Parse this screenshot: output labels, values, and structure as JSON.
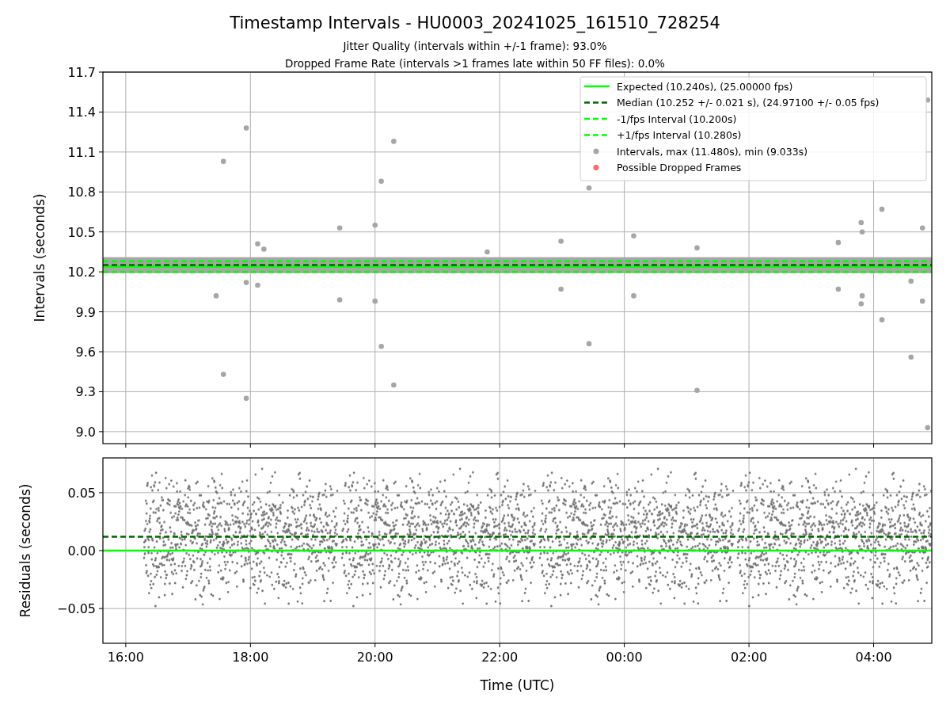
{
  "figure": {
    "title": "Timestamp Intervals - HU0003_20241025_161510_728254",
    "subtitles": [
      "Jitter Quality (intervals within +/-1 frame): 93.0%",
      "Dropped Frame Rate (intervals >1 frames late within 50 FF files): 0.0%"
    ],
    "panels": [
      {
        "kind": "intervals",
        "chart_data": {
          "type": "scatter",
          "ylabel": "Intervals (seconds)",
          "grid": true,
          "legend": "upper right",
          "bands": [
            {
              "axis": "y",
              "from": 10.19,
              "to": 10.31,
              "color": "#a6a6a6"
            }
          ],
          "xlim": [
            "2024-10-25 15:38",
            "2024-10-26 04:56"
          ],
          "ylim": [
            8.91,
            11.7
          ],
          "yticks": [
            {
              "value": 9.0,
              "label": "9.0"
            },
            {
              "value": 9.3,
              "label": "9.3"
            },
            {
              "value": 9.6,
              "label": "9.6"
            },
            {
              "value": 9.9,
              "label": "9.9"
            },
            {
              "value": 10.2,
              "label": "10.2"
            },
            {
              "value": 10.5,
              "label": "10.5"
            },
            {
              "value": 10.8,
              "label": "10.8"
            },
            {
              "value": 11.1,
              "label": "11.1"
            },
            {
              "value": 11.4,
              "label": "11.4"
            },
            {
              "value": 11.7,
              "label": "11.7"
            }
          ],
          "series": [
            {
              "name": "Expected (10.240s), (25.00000 fps)",
              "type": "line",
              "line_style": "solid",
              "color": "#00ff00",
              "x": [
                "2024-10-25 15:38",
                "2024-10-26 04:56"
              ],
              "values": [
                10.24,
                10.24
              ]
            },
            {
              "name": "Median (10.252 +/- 0.021 s), (24.97100 +/- 0.05 fps)",
              "type": "line",
              "line_style": "dashed",
              "color": "#006400",
              "x": [
                "2024-10-25 15:38",
                "2024-10-26 04:56"
              ],
              "values": [
                10.252,
                10.252
              ]
            },
            {
              "name": "-1/fps Interval (10.200s)",
              "type": "line",
              "line_style": "dashed",
              "color": "#00ff00",
              "x": [
                "2024-10-25 15:38",
                "2024-10-26 04:56"
              ],
              "values": [
                10.2,
                10.2
              ]
            },
            {
              "name": "+1/fps Interval (10.280s)",
              "type": "line",
              "line_style": "dashed",
              "color": "#00ff00",
              "x": [
                "2024-10-25 15:38",
                "2024-10-26 04:56"
              ],
              "values": [
                10.28,
                10.28
              ]
            },
            {
              "name": "Intervals, max (11.480s), min (9.033s)",
              "type": "scatter",
              "color": "#a6a6a6",
              "x": [
                "2024-10-25 17:34",
                "2024-10-25 17:56",
                "2024-10-25 20:06",
                "2024-10-25 20:18",
                "2024-10-25 20:00",
                "2024-10-25 19:26",
                "2024-10-25 19:26",
                "2024-10-25 20:00",
                "2024-10-25 20:06",
                "2024-10-25 20:18",
                "2024-10-25 17:34",
                "2024-10-25 17:56",
                "2024-10-25 17:27",
                "2024-10-25 17:56",
                "2024-10-25 18:07",
                "2024-10-25 18:07",
                "2024-10-25 18:13",
                "2024-10-25 22:59",
                "2024-10-25 22:59",
                "2024-10-25 23:26",
                "2024-10-25 23:26",
                "2024-10-26 00:09",
                "2024-10-26 00:09",
                "2024-10-26 01:10",
                "2024-10-26 01:10",
                "2024-10-26 03:26",
                "2024-10-26 03:26",
                "2024-10-26 03:48",
                "2024-10-26 03:49",
                "2024-10-26 03:49",
                "2024-10-26 03:48",
                "2024-10-26 04:08",
                "2024-10-26 04:08",
                "2024-10-26 04:36",
                "2024-10-26 04:36",
                "2024-10-26 04:47",
                "2024-10-26 04:47",
                "2024-10-26 04:52",
                "2024-10-26 04:52",
                "2024-10-25 21:48"
              ],
              "values": [
                11.03,
                11.28,
                10.88,
                11.18,
                10.55,
                10.53,
                9.99,
                9.98,
                9.64,
                9.35,
                9.43,
                9.25,
                10.02,
                10.12,
                10.1,
                10.41,
                10.37,
                10.07,
                10.43,
                10.83,
                9.66,
                10.47,
                10.02,
                10.38,
                9.31,
                10.42,
                10.07,
                10.57,
                10.5,
                10.02,
                9.96,
                10.67,
                9.84,
                9.56,
                10.13,
                10.53,
                9.98,
                11.49,
                9.03,
                10.35
              ]
            }
          ]
        },
        "legend_extra": [
          {
            "label": "Possible Dropped Frames",
            "color": "#ff6666"
          }
        ]
      },
      {
        "kind": "residuals",
        "chart_data": {
          "type": "scatter",
          "grid": true,
          "bands": [
            {
              "axis": "y",
              "from": -0.052,
              "to": 0.072,
              "color": "#707070"
            }
          ],
          "xlabel": "Time (UTC)",
          "ylabel": "Residuals (seconds)",
          "xlim": [
            "2024-10-25 15:38",
            "2024-10-26 04:56"
          ],
          "ylim": [
            -0.08,
            0.08
          ],
          "xticks": [
            {
              "value": "2024-10-25 16:00",
              "label": "16:00"
            },
            {
              "value": "2024-10-25 18:00",
              "label": "18:00"
            },
            {
              "value": "2024-10-25 20:00",
              "label": "20:00"
            },
            {
              "value": "2024-10-25 22:00",
              "label": "22:00"
            },
            {
              "value": "2024-10-26 00:00",
              "label": "00:00"
            },
            {
              "value": "2024-10-26 02:00",
              "label": "02:00"
            },
            {
              "value": "2024-10-26 04:00",
              "label": "04:00"
            }
          ],
          "yticks": [
            {
              "value": -0.05,
              "label": "−0.05"
            },
            {
              "value": 0,
              "label": "0.00"
            },
            {
              "value": 0.05,
              "label": "0.05"
            }
          ],
          "series": [
            {
              "type": "line",
              "line_style": "dashed",
              "color": "#006400",
              "x": [
                "2024-10-25 15:38",
                "2024-10-26 04:56"
              ],
              "values": [
                0.012,
                0.012
              ]
            },
            {
              "type": "line",
              "line_style": "solid",
              "color": "#00ff00",
              "x": [
                "2024-10-25 15:38",
                "2024-10-26 04:56"
              ],
              "values": [
                0,
                0
              ]
            }
          ]
        }
      }
    ]
  }
}
